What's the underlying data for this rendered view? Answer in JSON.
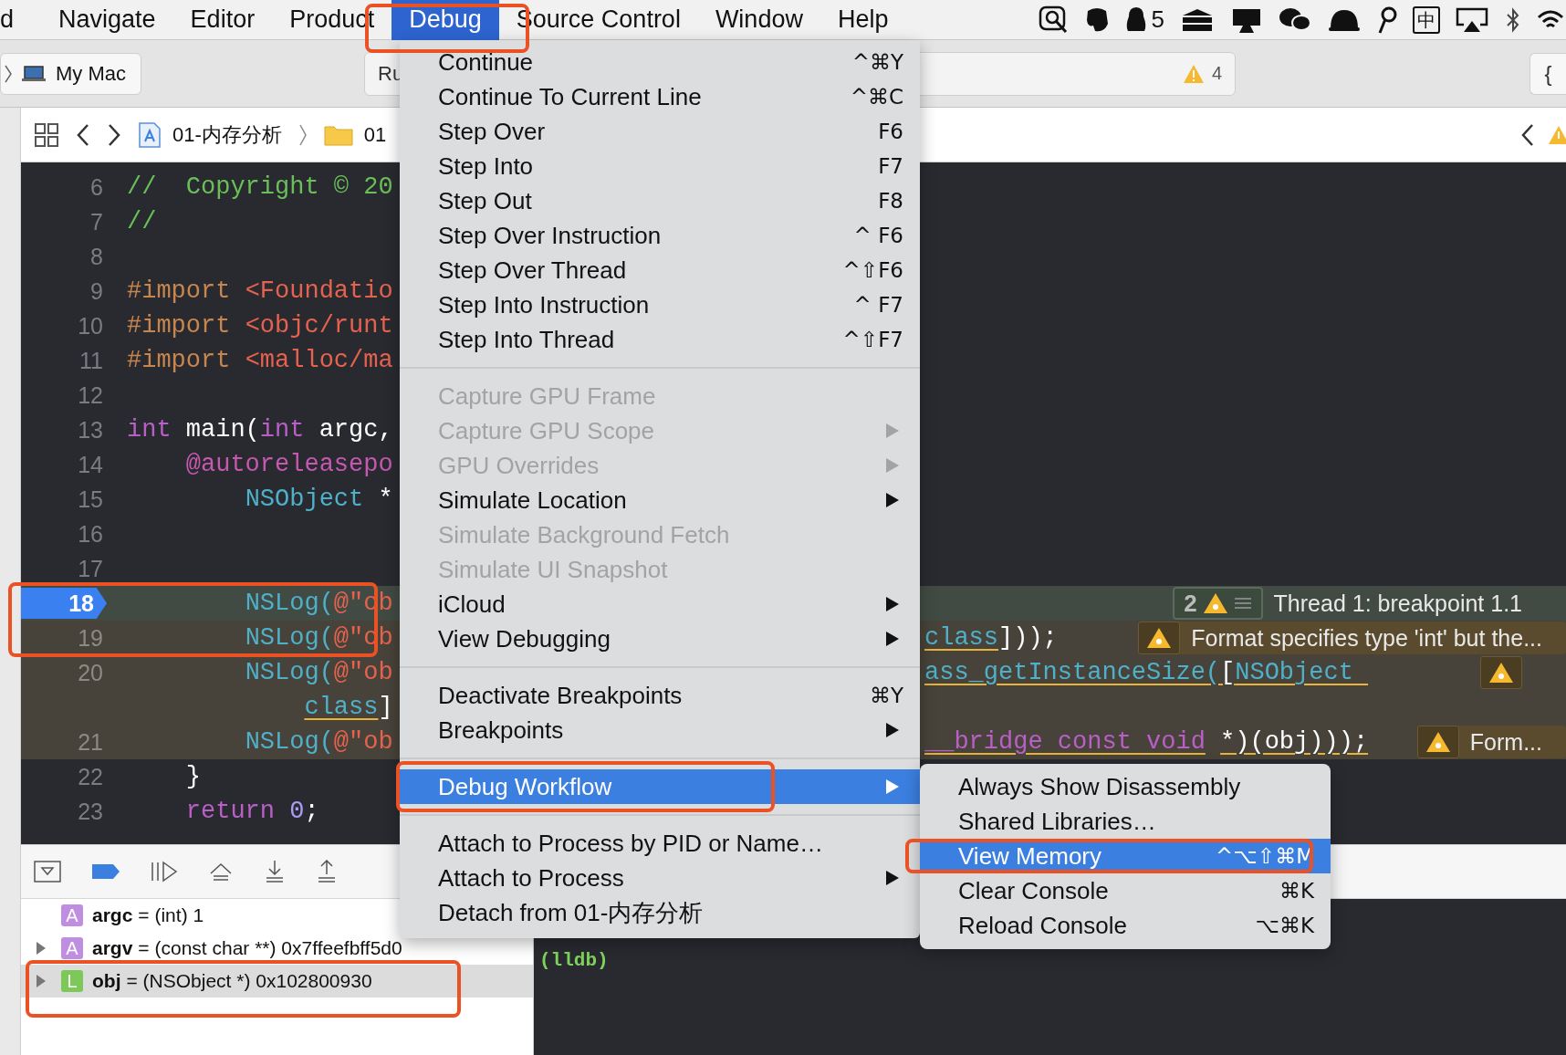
{
  "menu_bar": {
    "items": [
      {
        "label": "d",
        "selected": false
      },
      {
        "label": "Navigate",
        "selected": false
      },
      {
        "label": "Editor",
        "selected": false
      },
      {
        "label": "Product",
        "selected": false
      },
      {
        "label": "Debug",
        "selected": true
      },
      {
        "label": "Source Control",
        "selected": false
      },
      {
        "label": "Window",
        "selected": false
      },
      {
        "label": "Help",
        "selected": false
      }
    ],
    "notification_count": "5",
    "input_method": "中"
  },
  "toolbar": {
    "scheme": "My Mac",
    "activity_text": "Ru",
    "warning_count": "4",
    "library_button": "{"
  },
  "jump_bar": {
    "crumbs": [
      "01-内存分析",
      "01"
    ]
  },
  "editor": {
    "lines": [
      {
        "number": "6",
        "kind": "normal",
        "left": [
          {
            "t": "//  Copyright © 20",
            "kind": "comment"
          }
        ]
      },
      {
        "number": "7",
        "kind": "normal",
        "left": [
          {
            "t": "//",
            "kind": "comment"
          }
        ]
      },
      {
        "number": "8",
        "kind": "normal"
      },
      {
        "number": "9",
        "kind": "normal",
        "left": [
          {
            "t": "#import",
            "kind": "preprocessor"
          },
          {
            "t": " <Foundatio",
            "kind": "string"
          }
        ]
      },
      {
        "number": "10",
        "kind": "normal",
        "left": [
          {
            "t": "#import",
            "kind": "preprocessor"
          },
          {
            "t": " <objc/runt",
            "kind": "string"
          }
        ]
      },
      {
        "number": "11",
        "kind": "normal",
        "left": [
          {
            "t": "#import",
            "kind": "preprocessor"
          },
          {
            "t": " <malloc/ma",
            "kind": "string"
          }
        ]
      },
      {
        "number": "12",
        "kind": "normal"
      },
      {
        "number": "13",
        "kind": "normal",
        "left": [
          {
            "t": "int",
            "kind": "keyword"
          },
          {
            "t": " main(",
            "kind": "plain"
          },
          {
            "t": "int",
            "kind": "keyword"
          },
          {
            "t": " argc,",
            "kind": "plain"
          }
        ]
      },
      {
        "number": "14",
        "kind": "normal",
        "left": [
          {
            "t": "    @autoreleasepo",
            "kind": "attribute"
          }
        ]
      },
      {
        "number": "15",
        "kind": "normal",
        "left": [
          {
            "t": "        NSObject",
            "kind": "type"
          },
          {
            "t": " *",
            "kind": "plain"
          }
        ]
      },
      {
        "number": "16",
        "kind": "normal"
      },
      {
        "number": "17",
        "kind": "normal"
      },
      {
        "number": "18",
        "kind": "current",
        "left": [
          {
            "t": "        NSLog(",
            "kind": "type"
          },
          {
            "t": "@\"ob",
            "kind": "string"
          }
        ],
        "annotation": {
          "kind": "thread",
          "count": "2",
          "text": "Thread 1: breakpoint 1.1"
        }
      },
      {
        "number": "19",
        "kind": "warning",
        "left": [
          {
            "t": "        NSLog(",
            "kind": "type"
          },
          {
            "t": "@\"ob",
            "kind": "string"
          }
        ],
        "right": [
          {
            "t": "class",
            "kind": "type",
            "underlined": true
          },
          {
            "t": "]));",
            "kind": "plain"
          }
        ],
        "annotation": {
          "kind": "warning",
          "text": "Format specifies type 'int' but the..."
        }
      },
      {
        "number": "20",
        "kind": "warning",
        "left": [
          {
            "t": "        NSLog(",
            "kind": "type"
          },
          {
            "t": "@\"ob",
            "kind": "string"
          }
        ],
        "right": [
          {
            "t": "ass_getInstanceSize(",
            "kind": "type",
            "underlined": true
          },
          {
            "t": "[",
            "kind": "plain",
            "underlined": true
          },
          {
            "t": "NSObject ",
            "kind": "type",
            "underlined": true
          }
        ],
        "annotation": {
          "kind": "warning"
        }
      },
      {
        "kind": "warning",
        "left": [
          {
            "t": "            class",
            "kind": "type",
            "underlined": true
          },
          {
            "t": "]",
            "kind": "plain"
          }
        ]
      },
      {
        "number": "21",
        "kind": "warning",
        "left": [
          {
            "t": "        NSLog(",
            "kind": "type"
          },
          {
            "t": "@\"ob",
            "kind": "string"
          }
        ],
        "right": [
          {
            "t": "__bridge const void",
            "kind": "keyword",
            "underlined": true
          },
          {
            "t": " *)(obj)));",
            "kind": "plain",
            "underlined": true
          }
        ],
        "annotation": {
          "kind": "warning",
          "text": "Form..."
        }
      },
      {
        "number": "22",
        "kind": "normal",
        "left": [
          {
            "t": "    }",
            "kind": "plain"
          }
        ]
      },
      {
        "number": "23",
        "kind": "normal",
        "left": [
          {
            "t": "    return",
            "kind": "keyword"
          },
          {
            "t": " 0",
            "kind": "number"
          },
          {
            "t": ";",
            "kind": "plain"
          }
        ]
      }
    ]
  },
  "debug_menu": {
    "items": [
      {
        "kind": "item",
        "label": "Continue",
        "shortcut": "^⌘Y",
        "disabled": false,
        "submenu": false,
        "selected": false
      },
      {
        "kind": "item",
        "label": "Continue To Current Line",
        "shortcut": "^⌘C",
        "disabled": false,
        "submenu": false,
        "selected": false
      },
      {
        "kind": "item",
        "label": "Step Over",
        "shortcut": "F6",
        "disabled": false,
        "submenu": false,
        "selected": false
      },
      {
        "kind": "item",
        "label": "Step Into",
        "shortcut": "F7",
        "disabled": false,
        "submenu": false,
        "selected": false
      },
      {
        "kind": "item",
        "label": "Step Out",
        "shortcut": "F8",
        "disabled": false,
        "submenu": false,
        "selected": false
      },
      {
        "kind": "item",
        "label": "Step Over Instruction",
        "shortcut": "^ F6",
        "disabled": false,
        "submenu": false,
        "selected": false
      },
      {
        "kind": "item",
        "label": "Step Over Thread",
        "shortcut": "^⇧F6",
        "disabled": false,
        "submenu": false,
        "selected": false
      },
      {
        "kind": "item",
        "label": "Step Into Instruction",
        "shortcut": "^ F7",
        "disabled": false,
        "submenu": false,
        "selected": false
      },
      {
        "kind": "item",
        "label": "Step Into Thread",
        "shortcut": "^⇧F7",
        "disabled": false,
        "submenu": false,
        "selected": false
      },
      {
        "kind": "separator"
      },
      {
        "kind": "item",
        "label": "Capture GPU Frame",
        "disabled": true,
        "submenu": false,
        "selected": false
      },
      {
        "kind": "item",
        "label": "Capture GPU Scope",
        "disabled": true,
        "submenu": true,
        "selected": false
      },
      {
        "kind": "item",
        "label": "GPU Overrides",
        "disabled": true,
        "submenu": true,
        "selected": false
      },
      {
        "kind": "item",
        "label": "Simulate Location",
        "disabled": false,
        "submenu": true,
        "selected": false
      },
      {
        "kind": "item",
        "label": "Simulate Background Fetch",
        "disabled": true,
        "submenu": false,
        "selected": false
      },
      {
        "kind": "item",
        "label": "Simulate UI Snapshot",
        "disabled": true,
        "submenu": false,
        "selected": false
      },
      {
        "kind": "item",
        "label": "iCloud",
        "disabled": false,
        "submenu": true,
        "selected": false
      },
      {
        "kind": "item",
        "label": "View Debugging",
        "disabled": false,
        "submenu": true,
        "selected": false
      },
      {
        "kind": "separator"
      },
      {
        "kind": "item",
        "label": "Deactivate Breakpoints",
        "shortcut": "⌘Y",
        "disabled": false,
        "submenu": false,
        "selected": false
      },
      {
        "kind": "item",
        "label": "Breakpoints",
        "disabled": false,
        "submenu": true,
        "selected": false
      },
      {
        "kind": "separator"
      },
      {
        "kind": "item",
        "label": "Debug Workflow",
        "disabled": false,
        "submenu": true,
        "selected": true
      },
      {
        "kind": "separator"
      },
      {
        "kind": "item",
        "label": "Attach to Process by PID or Name…",
        "disabled": false,
        "submenu": false,
        "selected": false
      },
      {
        "kind": "item",
        "label": "Attach to Process",
        "disabled": false,
        "submenu": true,
        "selected": false
      },
      {
        "kind": "item",
        "label": "Detach from 01-内存分析",
        "disabled": false,
        "submenu": false,
        "selected": false
      }
    ]
  },
  "workflow_submenu": {
    "items": [
      {
        "label": "Always Show Disassembly",
        "selected": false
      },
      {
        "label": "Shared Libraries…",
        "selected": false
      },
      {
        "label": "View Memory",
        "shortcut": "^⌥⇧⌘M",
        "selected": true
      },
      {
        "label": "Clear Console",
        "shortcut": "⌘K",
        "selected": false
      },
      {
        "label": "Reload Console",
        "shortcut": "⌥⌘K",
        "selected": false
      }
    ]
  },
  "variables": [
    {
      "scope": "A",
      "kind": "argument",
      "name": "argc",
      "value": "= (int) 1",
      "expandable": false,
      "selected": false
    },
    {
      "scope": "A",
      "kind": "argument",
      "name": "argv",
      "value": "= (const char **) 0x7ffeefbff5d0",
      "expandable": true,
      "selected": false
    },
    {
      "scope": "L",
      "kind": "local",
      "name": "obj",
      "value": "= (NSObject *) 0x102800930",
      "expandable": true,
      "selected": true
    }
  ],
  "console": {
    "prompt": "(lldb)"
  }
}
